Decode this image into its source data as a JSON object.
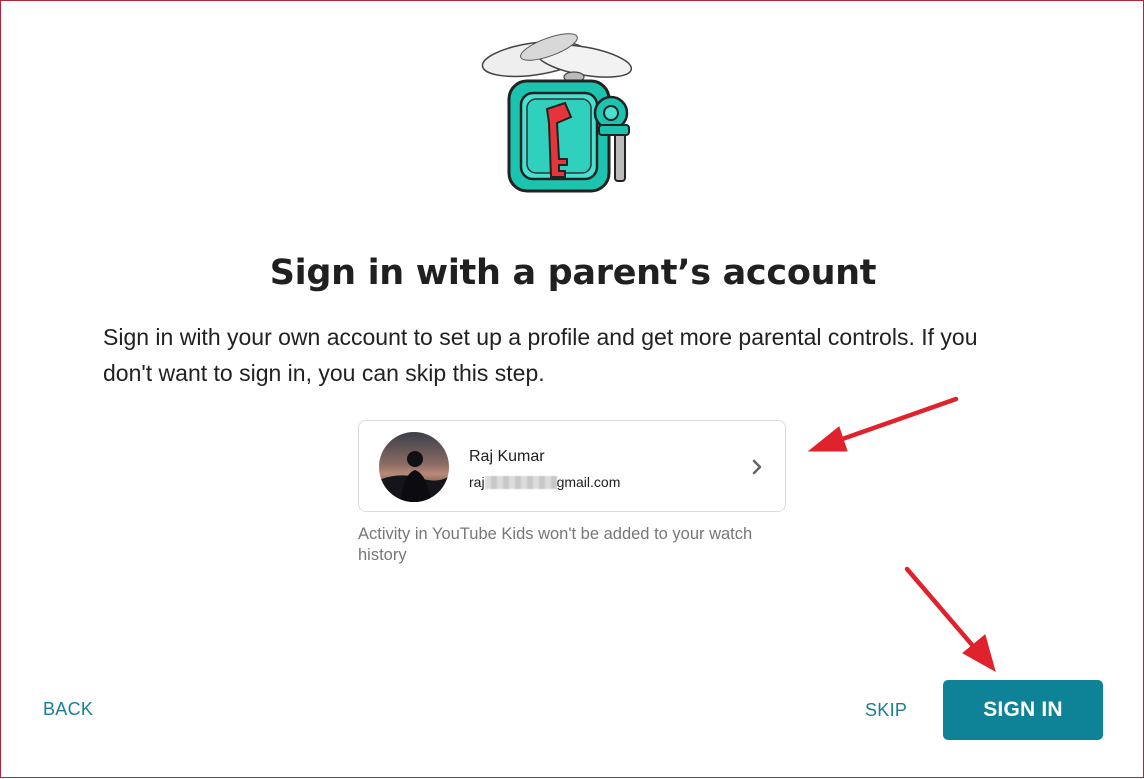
{
  "dialog": {
    "title": "Sign in with a parent’s account",
    "description": "Sign in with your own account to set up a profile and get more parental controls. If you don't want to sign in, you can skip this step.",
    "illustration_icon": "key-robot-illustration"
  },
  "account": {
    "name": "Raj Kumar",
    "email_prefix": "raj",
    "email_suffix": "gmail.com",
    "avatar_icon": "avatar-silhouette",
    "chevron_icon": "chevron-right-icon"
  },
  "note": "Activity in YouTube Kids won't be added to your watch history",
  "actions": {
    "back_label": "BACK",
    "skip_label": "SKIP",
    "signin_label": "SIGN IN"
  },
  "colors": {
    "accent": "#0e8296",
    "link": "#1a7e95",
    "annotation_arrow": "#e0222c",
    "frame_border": "#b4243a"
  }
}
